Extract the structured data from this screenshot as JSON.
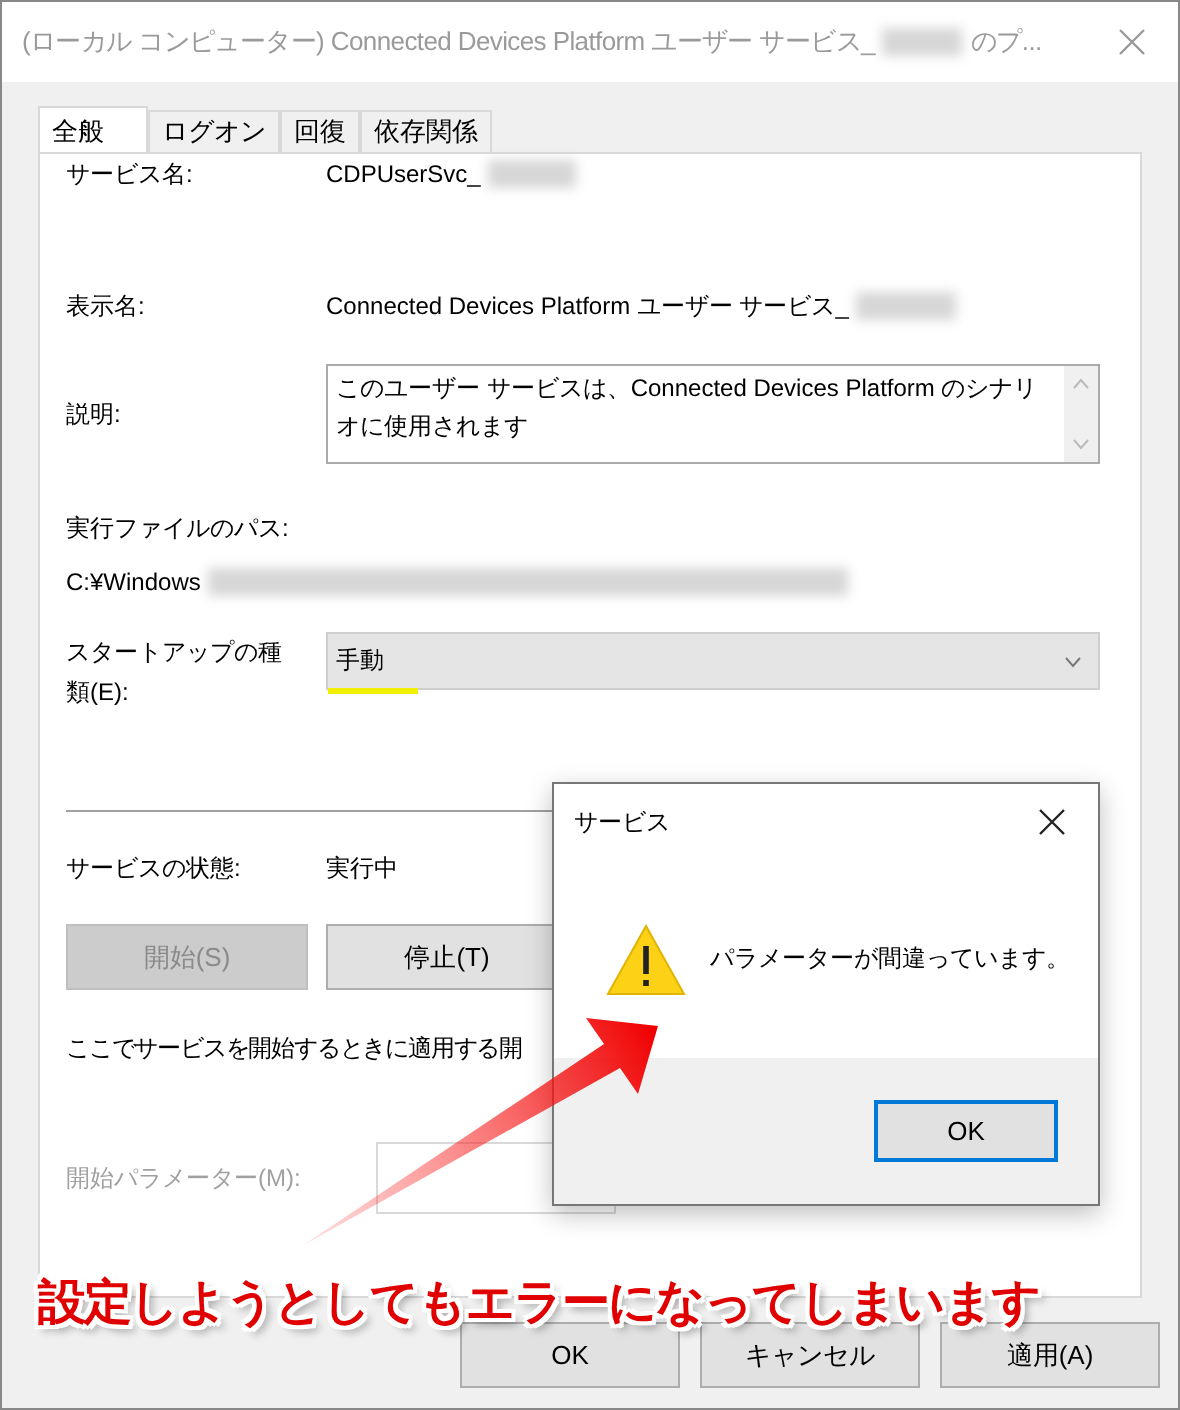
{
  "window": {
    "title_start": "(ローカル コンピューター) Connected Devices Platform ユーザー サービス_",
    "title_end": "のプ..."
  },
  "tabs": [
    {
      "label": "全般",
      "selected": true
    },
    {
      "label": "ログオン",
      "selected": false
    },
    {
      "label": "回復",
      "selected": false
    },
    {
      "label": "依存関係",
      "selected": false
    }
  ],
  "service_name": {
    "label": "サービス名:",
    "value": "CDPUserSvc_"
  },
  "display_name": {
    "label": "表示名:",
    "value": "Connected Devices Platform ユーザー サービス_"
  },
  "description": {
    "label": "説明:",
    "value": "このユーザー サービスは、Connected Devices Platform のシナリオに使用されます"
  },
  "executable_path": {
    "label": "実行ファイルのパス:",
    "value": "C:¥Windows"
  },
  "startup_type": {
    "label": "スタートアップの種類(E):",
    "value": "手動"
  },
  "service_status": {
    "label": "サービスの状態:",
    "value": "実行中"
  },
  "control_buttons": [
    {
      "label": "開始(S)",
      "disabled": true
    },
    {
      "label": "停止(T)",
      "disabled": false
    }
  ],
  "hint": "ここでサービスを開始するときに適用する開",
  "start_parameters": {
    "label": "開始パラメーター(M):",
    "disabled": true
  },
  "footer_buttons": [
    "OK",
    "キャンセル",
    "適用(A)"
  ],
  "message_box": {
    "title": "サービス",
    "message": "パラメーターが間違っています。",
    "button": "OK"
  },
  "annotation": "設定しようとしてもエラーになってしまいます"
}
